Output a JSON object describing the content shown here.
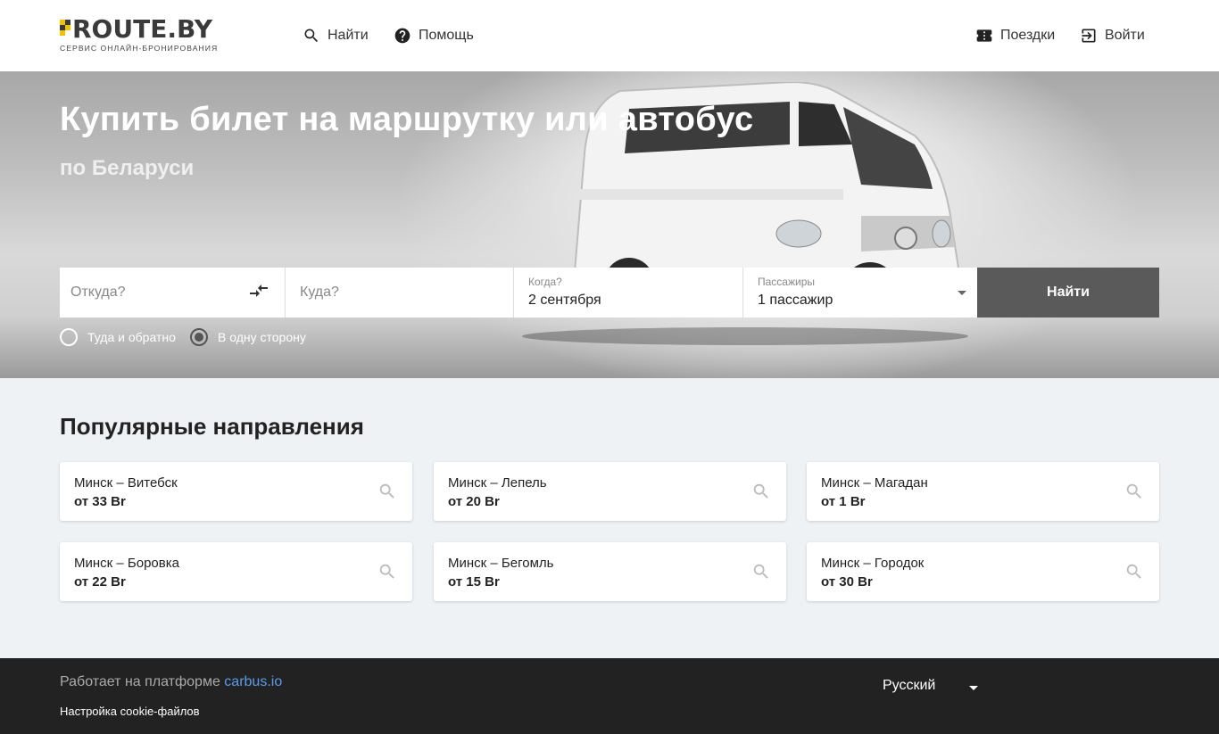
{
  "header": {
    "logo_text": "ROUTE.BY",
    "logo_subtitle": "СЕРВИС ОНЛАЙН-БРОНИРОВАНИЯ",
    "nav_left": [
      {
        "label": "Найти",
        "icon": "search-icon"
      },
      {
        "label": "Помощь",
        "icon": "help-icon"
      }
    ],
    "nav_right": [
      {
        "label": "Поездки",
        "icon": "ticket-icon"
      },
      {
        "label": "Войти",
        "icon": "login-icon"
      }
    ]
  },
  "hero": {
    "title": "Купить билет на маршрутку или автобус",
    "subtitle": "по Беларуси"
  },
  "search": {
    "from_placeholder": "Откуда?",
    "to_placeholder": "Куда?",
    "when_label": "Когда?",
    "when_value": "2 сентября",
    "passengers_label": "Пассажиры",
    "passengers_value": "1 пассажир",
    "submit_label": "Найти"
  },
  "trip_type": {
    "options": [
      {
        "label": "Туда и обратно",
        "checked": false
      },
      {
        "label": "В одну сторону",
        "checked": true
      }
    ]
  },
  "popular": {
    "title": "Популярные направления",
    "routes": [
      {
        "route": "Минск – Витебск",
        "price": "от 33 Br"
      },
      {
        "route": "Минск – Лепель",
        "price": "от 20 Br"
      },
      {
        "route": "Минск – Магадан",
        "price": "от 1 Br"
      },
      {
        "route": "Минск – Боровка",
        "price": "от 22 Br"
      },
      {
        "route": "Минск – Бегомль",
        "price": "от 15 Br"
      },
      {
        "route": "Минск – Городок",
        "price": "от 30 Br"
      }
    ]
  },
  "footer": {
    "powered_prefix": "Работает на платформе ",
    "powered_link": "carbus.io",
    "cookie_settings": "Настройка cookie-файлов",
    "language": "Русский"
  },
  "colors": {
    "accent_link": "#5b9be8",
    "button_bg": "#5a5a5a",
    "footer_bg": "#222222",
    "logo_yellow": "#f2c200"
  }
}
